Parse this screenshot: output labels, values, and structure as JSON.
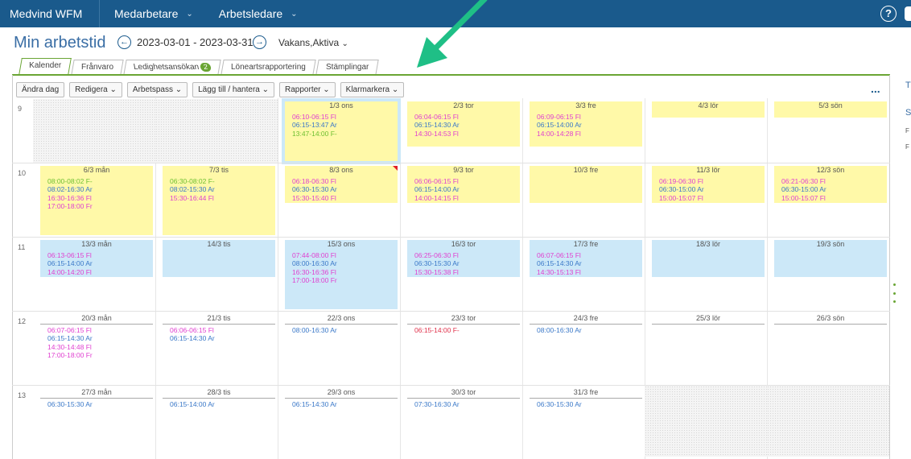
{
  "topbar": {
    "brand": "Medvind WFM",
    "menus": [
      {
        "label": "Medarbetare"
      },
      {
        "label": "Arbetsledare"
      }
    ],
    "help_label": "?"
  },
  "header": {
    "title": "Min arbetstid",
    "date_range": "2023-03-01 - 2023-03-31",
    "filter": "Vakans,Aktiva"
  },
  "tabs": [
    {
      "label": "Kalender",
      "active": true
    },
    {
      "label": "Frånvaro"
    },
    {
      "label": "Ledighetsansökan",
      "badge": "2"
    },
    {
      "label": "Löneartsrapportering"
    },
    {
      "label": "Stämplingar"
    }
  ],
  "toolbar": {
    "buttons": [
      "Ändra dag",
      "Redigera",
      "Arbetspass",
      "Lägg till / hantera",
      "Rapporter",
      "Klarmarkera"
    ],
    "more": "..."
  },
  "right_panel": {
    "t1": "T",
    "t2": "S",
    "t3": "F",
    "t4": "F"
  },
  "colors": {
    "topbar": "#1a5a8c",
    "accent_green": "#6aa534",
    "yellow_cell": "#fff9a8",
    "blue_cell": "#cce8f8",
    "fl_text": "#e040d0",
    "ar_text": "#3a78c8",
    "fminus_text": "#6cbf30",
    "arrow": "#1fbf86"
  },
  "weeks": [
    {
      "num": "9",
      "days": [
        null,
        null,
        {
          "label": "1/3 ons",
          "bg": "today",
          "lines": [
            [
              "06:10-06:15 Fl",
              "fl"
            ],
            [
              "06:15-13:47 Ar",
              "ar"
            ],
            [
              "13:47-14:00 F-",
              "fminus"
            ]
          ]
        },
        {
          "label": "2/3 tor",
          "bg": "yellow",
          "lines": [
            [
              "06:04-06:15 Fl",
              "fl"
            ],
            [
              "06:15-14:30 Ar",
              "ar"
            ],
            [
              "14:30-14:53 Fl",
              "fl"
            ]
          ]
        },
        {
          "label": "3/3 fre",
          "bg": "yellow",
          "lines": [
            [
              "06:09-06:15 Fl",
              "fl"
            ],
            [
              "06:15-14:00 Ar",
              "ar"
            ],
            [
              "14:00-14:28 Fl",
              "fl"
            ]
          ]
        },
        {
          "label": "4/3 lör",
          "bg": "yellow",
          "lines": []
        },
        {
          "label": "5/3 sön",
          "bg": "yellow",
          "lines": []
        }
      ]
    },
    {
      "num": "10",
      "days": [
        {
          "label": "6/3 mån",
          "bg": "yellow",
          "lines": [
            [
              "08:00-08:02 F-",
              "fminus"
            ],
            [
              "08:02-16:30 Ar",
              "ar"
            ],
            [
              "16:30-16:36 Fl",
              "fl"
            ],
            [
              "17:00-18:00 Fr",
              "fl"
            ]
          ]
        },
        {
          "label": "7/3 tis",
          "bg": "yellow",
          "lines": [
            [
              "06:30-08:02 F-",
              "fminus"
            ],
            [
              "08:02-15:30 Ar",
              "ar"
            ],
            [
              "15:30-16:44 Fl",
              "fl"
            ]
          ]
        },
        {
          "label": "8/3 ons",
          "bg": "yellow",
          "flag": true,
          "lines": [
            [
              "06:18-06:30 Fl",
              "fl"
            ],
            [
              "06:30-15:30 Ar",
              "ar"
            ],
            [
              "15:30-15:40 Fl",
              "fl"
            ]
          ]
        },
        {
          "label": "9/3 tor",
          "bg": "yellow",
          "lines": [
            [
              "06:06-06:15 Fl",
              "fl"
            ],
            [
              "06:15-14:00 Ar",
              "ar"
            ],
            [
              "14:00-14:15 Fl",
              "fl"
            ]
          ]
        },
        {
          "label": "10/3 fre",
          "bg": "yellow",
          "lines": []
        },
        {
          "label": "11/3 lör",
          "bg": "yellow",
          "lines": [
            [
              "06:19-06:30 Fl",
              "fl"
            ],
            [
              "06:30-15:00 Ar",
              "ar"
            ],
            [
              "15:00-15:07 Fl",
              "fl"
            ]
          ]
        },
        {
          "label": "12/3 sön",
          "bg": "yellow",
          "lines": [
            [
              "06:21-06:30 Fl",
              "fl"
            ],
            [
              "06:30-15:00 Ar",
              "ar"
            ],
            [
              "15:00-15:07 Fl",
              "fl"
            ]
          ]
        }
      ]
    },
    {
      "num": "11",
      "days": [
        {
          "label": "13/3 mån",
          "bg": "blue",
          "lines": [
            [
              "06:13-06:15 Fl",
              "fl"
            ],
            [
              "06:15-14:00 Ar",
              "ar"
            ],
            [
              "14:00-14:20 Fl",
              "fl"
            ]
          ]
        },
        {
          "label": "14/3 tis",
          "bg": "blue",
          "lines": []
        },
        {
          "label": "15/3 ons",
          "bg": "blue",
          "lines": [
            [
              "07:44-08:00 Fl",
              "fl"
            ],
            [
              "08:00-16:30 Ar",
              "ar"
            ],
            [
              "16:30-16:36 Fl",
              "fl"
            ],
            [
              "17:00-18:00 Fr",
              "fl"
            ]
          ]
        },
        {
          "label": "16/3 tor",
          "bg": "blue",
          "lines": [
            [
              "06:25-06:30 Fl",
              "fl"
            ],
            [
              "06:30-15:30 Ar",
              "ar"
            ],
            [
              "15:30-15:38 Fl",
              "fl"
            ]
          ]
        },
        {
          "label": "17/3 fre",
          "bg": "blue",
          "lines": [
            [
              "06:07-06:15 Fl",
              "fl"
            ],
            [
              "06:15-14:30 Ar",
              "ar"
            ],
            [
              "14:30-15:13 Fl",
              "fl"
            ]
          ]
        },
        {
          "label": "18/3 lör",
          "bg": "blue",
          "lines": []
        },
        {
          "label": "19/3 sön",
          "bg": "blue",
          "lines": []
        }
      ]
    },
    {
      "num": "12",
      "days": [
        {
          "label": "20/3 mån",
          "bg": "white",
          "lines": [
            [
              "06:07-06:15 Fl",
              "fl"
            ],
            [
              "06:15-14:30 Ar",
              "ar"
            ],
            [
              "14:30-14:48 Fl",
              "fl"
            ],
            [
              "17:00-18:00 Fr",
              "fl"
            ]
          ]
        },
        {
          "label": "21/3 tis",
          "bg": "white",
          "lines": [
            [
              "06:06-06:15 Fl",
              "fl"
            ],
            [
              "06:15-14:30 Ar",
              "ar"
            ]
          ]
        },
        {
          "label": "22/3 ons",
          "bg": "white",
          "lines": [
            [
              "08:00-16:30 Ar",
              "ar"
            ]
          ]
        },
        {
          "label": "23/3 tor",
          "bg": "white",
          "lines": [
            [
              "06:15-14:00 F-",
              "fred"
            ]
          ]
        },
        {
          "label": "24/3 fre",
          "bg": "white",
          "lines": [
            [
              "08:00-16:30 Ar",
              "ar"
            ]
          ]
        },
        {
          "label": "25/3 lör",
          "bg": "white",
          "lines": []
        },
        {
          "label": "26/3 sön",
          "bg": "white",
          "lines": []
        }
      ]
    },
    {
      "num": "13",
      "days": [
        {
          "label": "27/3 mån",
          "bg": "white",
          "lines": [
            [
              "06:30-15:30 Ar",
              "ar"
            ]
          ]
        },
        {
          "label": "28/3 tis",
          "bg": "white",
          "lines": [
            [
              "06:15-14:00 Ar",
              "ar"
            ]
          ]
        },
        {
          "label": "29/3 ons",
          "bg": "white",
          "lines": [
            [
              "06:15-14:30 Ar",
              "ar"
            ]
          ]
        },
        {
          "label": "30/3 tor",
          "bg": "white",
          "lines": [
            [
              "07:30-16:30 Ar",
              "ar"
            ]
          ]
        },
        {
          "label": "31/3 fre",
          "bg": "white",
          "lines": [
            [
              "06:30-15:30 Ar",
              "ar"
            ]
          ]
        },
        null,
        null
      ]
    }
  ]
}
